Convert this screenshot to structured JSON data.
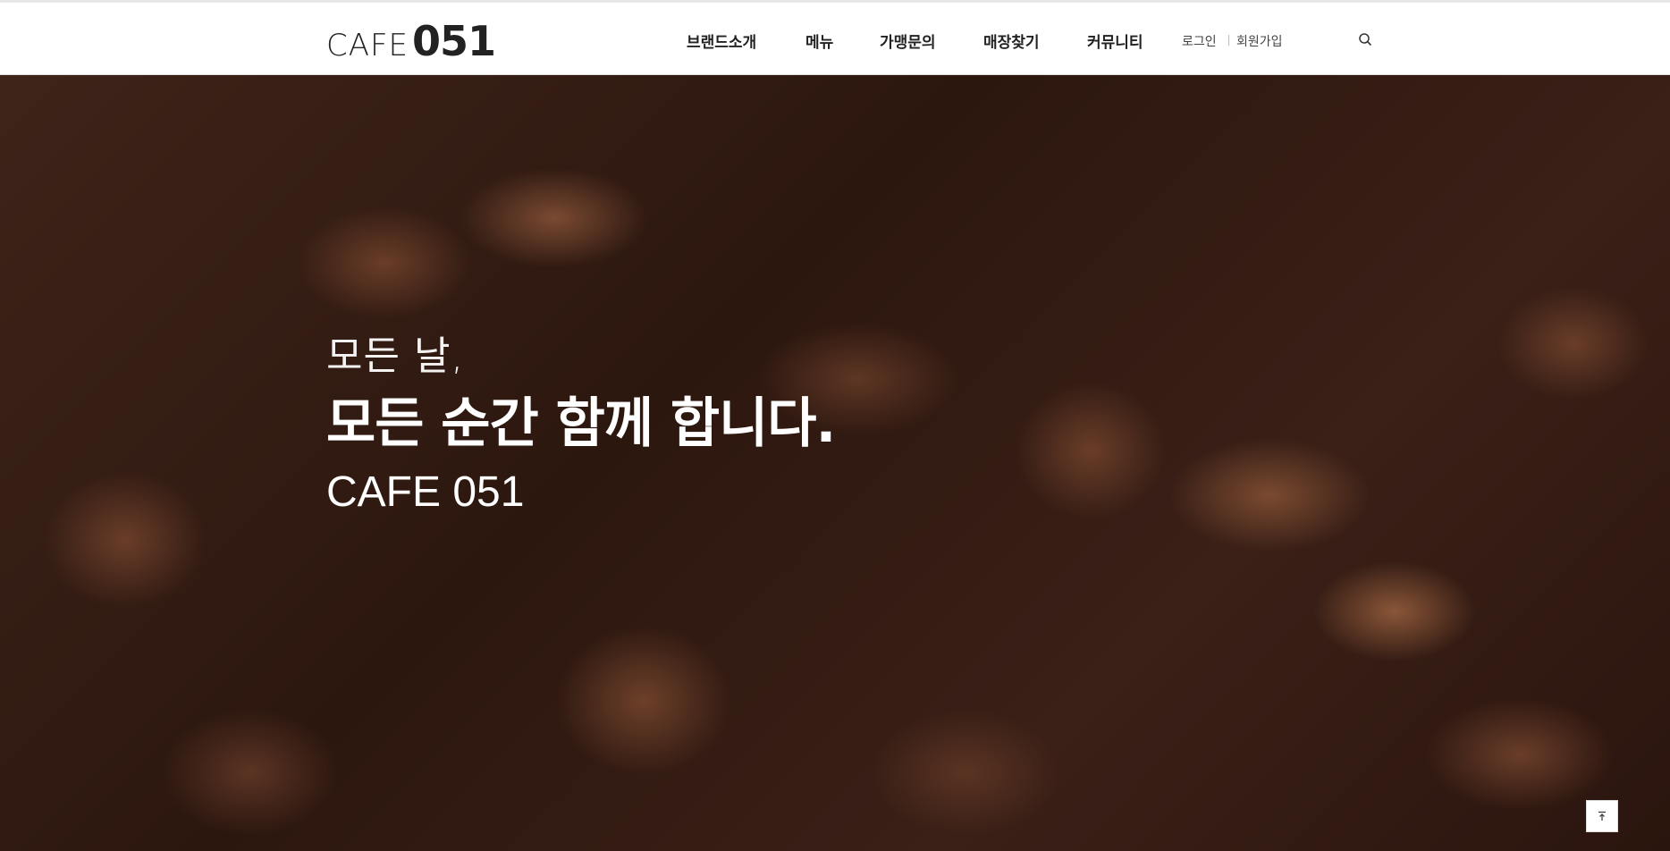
{
  "header": {
    "logo": {
      "light": "CAFE",
      "bold": "051"
    },
    "nav": [
      {
        "label": "브랜드소개"
      },
      {
        "label": "메뉴"
      },
      {
        "label": "가맹문의"
      },
      {
        "label": "매장찾기"
      },
      {
        "label": "커뮤니티"
      }
    ],
    "utility": {
      "login": "로그인",
      "signup": "회원가입",
      "search_icon": "search-icon"
    }
  },
  "hero": {
    "line1": "모든 날,",
    "line2": "모든 순간 함께 합니다.",
    "line3": "CAFE 051",
    "background": "coffee-beans-photo"
  },
  "scroll_top": {
    "icon": "arrow-up-to-top-icon"
  },
  "colors": {
    "header_bg": "#ffffff",
    "text_dark": "#222222",
    "hero_brown": "#3e2419"
  }
}
